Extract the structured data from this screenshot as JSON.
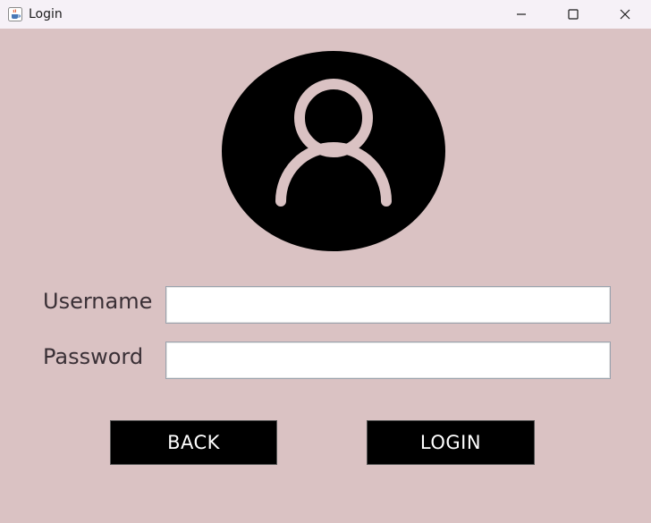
{
  "window": {
    "title": "Login",
    "app_icon": "java-cup-icon",
    "controls": [
      "minimize-icon",
      "maximize-icon",
      "close-icon"
    ]
  },
  "avatar": {
    "icon": "user-profile-icon"
  },
  "form": {
    "username_label": "Username",
    "username_value": "",
    "password_label": "Password",
    "password_value": ""
  },
  "buttons": {
    "back_label": "BACK",
    "login_label": "LOGIN"
  },
  "colors": {
    "background": "#dac2c3",
    "titlebar": "#f6f1f7",
    "button": "#000000",
    "button_text": "#ffffff"
  }
}
